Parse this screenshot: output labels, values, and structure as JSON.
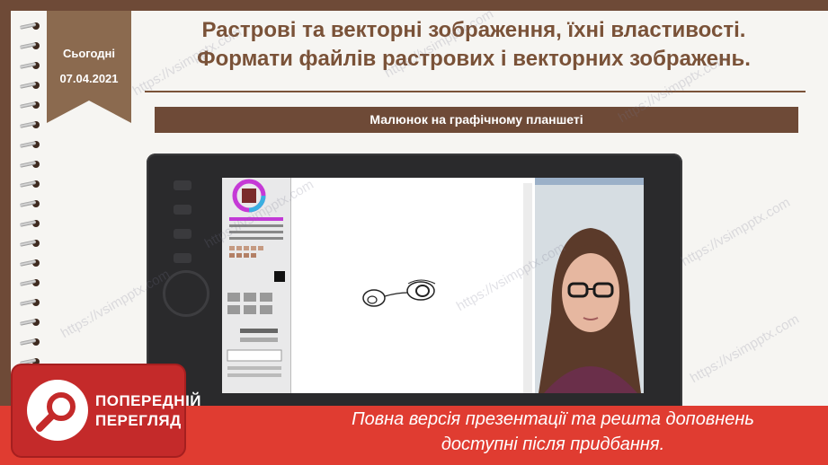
{
  "date_tag": {
    "label": "Сьогодні",
    "date": "07.04.2021"
  },
  "title": {
    "line1": "Растрові та векторні зображення, їхні властивості.",
    "line2": "Формати файлів растрових і векторних зображень."
  },
  "subtitle": "Малюнок на графічному планшеті",
  "preview_badge": {
    "line1": "ПОПЕРЕДНІЙ",
    "line2": "ПЕРЕГЛЯД"
  },
  "banner": {
    "line1": "Повна версія презентації та решта доповнень",
    "line2": "доступні після придбання."
  },
  "watermark": "https://vsimpptx.com",
  "colors": {
    "brown": "#6e4a37",
    "title": "#7a5238",
    "red": "#e03c31",
    "paper": "#f6f5f2"
  }
}
